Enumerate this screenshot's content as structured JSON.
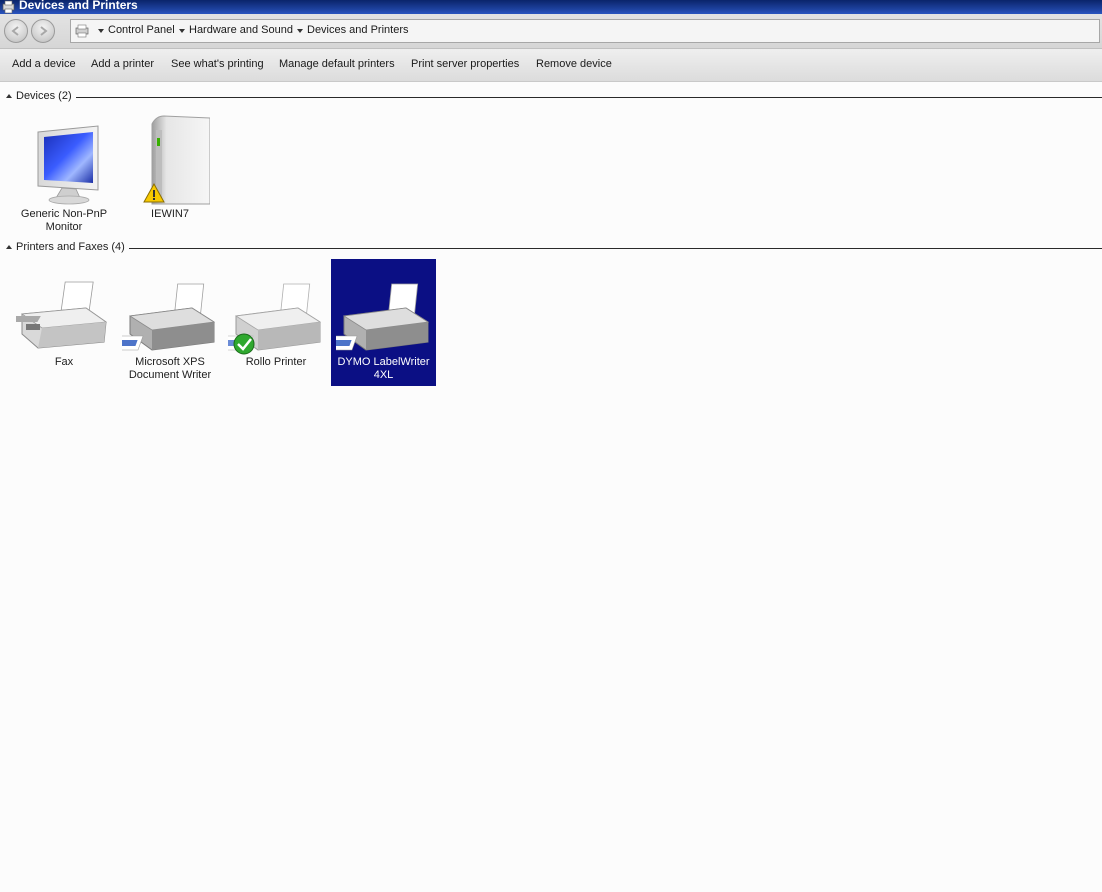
{
  "window": {
    "title": "Devices and Printers"
  },
  "address": {
    "crumbs": [
      "Control Panel",
      "Hardware and Sound",
      "Devices and Printers"
    ]
  },
  "commands": [
    "Add a device",
    "Add a printer",
    "See what's printing",
    "Manage default printers",
    "Print server properties",
    "Remove device"
  ],
  "groups": {
    "devices": {
      "label": "Devices (2)",
      "items": [
        {
          "caption": "Generic Non-PnP Monitor",
          "icon": "monitor-icon"
        },
        {
          "caption": "IEWIN7",
          "icon": "computer-tower-icon",
          "badge": "warning-icon"
        }
      ]
    },
    "printers": {
      "label": "Printers and Faxes (4)",
      "items": [
        {
          "caption": "Fax",
          "icon": "fax-icon"
        },
        {
          "caption": "Microsoft XPS Document Writer",
          "icon": "printer-icon"
        },
        {
          "caption": "Rollo Printer",
          "icon": "printer-icon",
          "badge": "default-check-icon"
        },
        {
          "caption": "DYMO LabelWriter 4XL",
          "icon": "printer-icon",
          "selected": true
        }
      ]
    }
  },
  "colors": {
    "selection": "#0b0f84",
    "titlebar": "#0a246a"
  }
}
